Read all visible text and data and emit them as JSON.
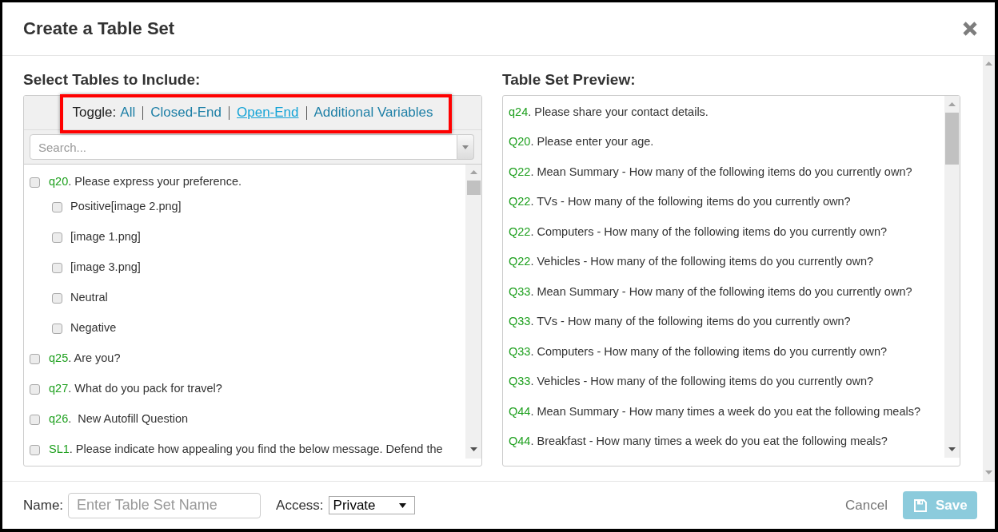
{
  "dialog": {
    "title": "Create a Table Set"
  },
  "left_panel": {
    "heading": "Select Tables to Include:",
    "toggle_bar": {
      "highlighted": true,
      "label": "Toggle:",
      "links": [
        {
          "label": "All",
          "hovered": false
        },
        {
          "label": "Closed-End",
          "hovered": false
        },
        {
          "label": "Open-End",
          "hovered": true
        },
        {
          "label": "Additional Variables",
          "hovered": false
        }
      ]
    },
    "search": {
      "placeholder": "Search..."
    },
    "items": [
      {
        "code": "q20",
        "text": ". Please express your preference.",
        "checked": false,
        "children": [
          {
            "text": "Positive[image 2.png]",
            "checked": false
          },
          {
            "text": "[image 1.png]",
            "checked": false
          },
          {
            "text": "[image 3.png]",
            "checked": false
          },
          {
            "text": "Neutral",
            "checked": false
          },
          {
            "text": "Negative",
            "checked": false
          }
        ]
      },
      {
        "code": "q25",
        "text": ". Are you?",
        "checked": false
      },
      {
        "code": "q27",
        "text": ". What do you pack for travel?",
        "checked": false
      },
      {
        "code": "q26",
        "text": ".  New Autofill Question",
        "checked": false
      },
      {
        "code": "SL1",
        "text": ". Please indicate how appealing you find the below message. Defend the",
        "checked": false
      }
    ]
  },
  "right_panel": {
    "heading": "Table Set Preview:",
    "items": [
      {
        "code": "q24",
        "text": ". Please share your contact details."
      },
      {
        "code": "Q20",
        "text": ". Please enter your age."
      },
      {
        "code": "Q22",
        "text": ". Mean Summary - How many of the following items do you currently own?"
      },
      {
        "code": "Q22",
        "text": ". TVs - How many of the following items do you currently own?"
      },
      {
        "code": "Q22",
        "text": ". Computers - How many of the following items do you currently own?"
      },
      {
        "code": "Q22",
        "text": ". Vehicles - How many of the following items do you currently own?"
      },
      {
        "code": "Q33",
        "text": ". Mean Summary - How many of the following items do you currently own?"
      },
      {
        "code": "Q33",
        "text": ". TVs - How many of the following items do you currently own?"
      },
      {
        "code": "Q33",
        "text": ". Computers - How many of the following items do you currently own?"
      },
      {
        "code": "Q33",
        "text": ". Vehicles - How many of the following items do you currently own?"
      },
      {
        "code": "Q44",
        "text": ". Mean Summary - How many times a week do you eat the following meals?"
      },
      {
        "code": "Q44",
        "text": ". Breakfast - How many times a week do you eat the following meals?"
      }
    ]
  },
  "footer": {
    "name_label": "Name:",
    "name_field": {
      "placeholder": "Enter Table Set Name"
    },
    "access_label": "Access:",
    "access_select": {
      "value": "Private"
    },
    "cancel": {
      "label": "Cancel"
    },
    "save": {
      "label": "Save",
      "disabled": true
    }
  }
}
